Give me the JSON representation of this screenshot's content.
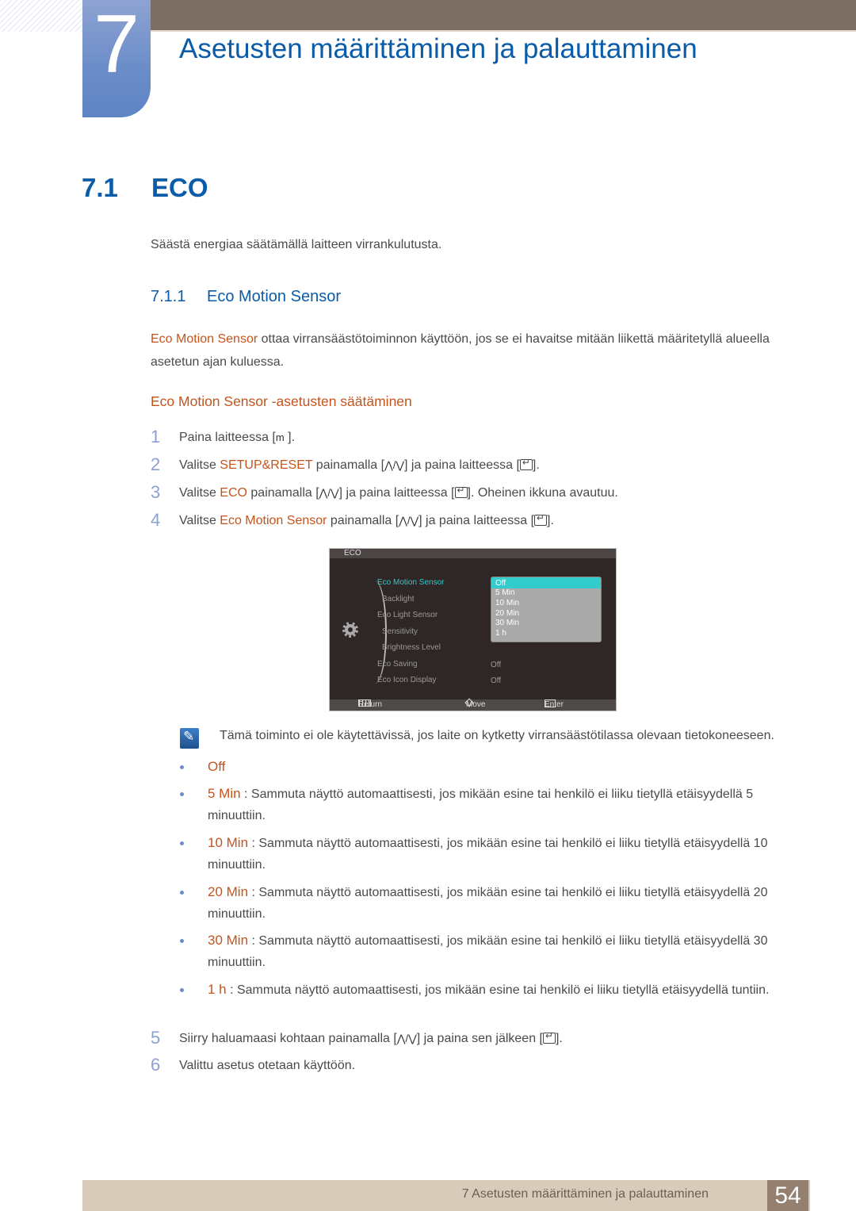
{
  "chapter": {
    "number": "7",
    "title": "Asetusten määrittäminen ja palauttaminen"
  },
  "section": {
    "number": "7.1",
    "title": "ECO",
    "intro": "Säästä energiaa säätämällä laitteen virrankulutusta."
  },
  "subsection": {
    "number": "7.1.1",
    "title": "Eco Motion Sensor",
    "para_term": "Eco Motion Sensor",
    "para_text": " ottaa virransäästötoiminnon käyttöön, jos se ei havaitse mitään liikettä määritetyllä alueella asetetun ajan kuluessa.",
    "procedure_heading": "Eco Motion Sensor -asetusten säätäminen"
  },
  "steps": [
    {
      "num": "1",
      "a": "Paina laitteessa [",
      "key": "m",
      "b": " ]."
    },
    {
      "num": "2",
      "a": "Valitse ",
      "term": "SETUP&RESET",
      "b": " painamalla [",
      "c": "] ja paina laitteessa [",
      "d": "]."
    },
    {
      "num": "3",
      "a": "Valitse ",
      "term": "ECO",
      "b": " painamalla [",
      "c": "] ja paina laitteessa [",
      "d": "]. Oheinen ikkuna avautuu."
    },
    {
      "num": "4",
      "a": "Valitse ",
      "term": "Eco Motion Sensor",
      "b": " painamalla [",
      "c": "] ja paina laitteessa [",
      "d": "]."
    },
    {
      "num": "5",
      "a": "Siirry haluamaasi kohtaan painamalla [",
      "c": "] ja paina sen jälkeen [",
      "d": "]."
    },
    {
      "num": "6",
      "a": "Valittu asetus otetaan käyttöön."
    }
  ],
  "arrows_glyph": "⋀/⋁",
  "osd": {
    "title": "ECO",
    "items": [
      {
        "label": "Eco Motion Sensor",
        "selected": true
      },
      {
        "label": "Backlight"
      },
      {
        "label": "Eco Light Sensor"
      },
      {
        "label": "Sensitivity"
      },
      {
        "label": "Brightness Level"
      },
      {
        "label": "Eco Saving",
        "value": "Off"
      },
      {
        "label": "Eco Icon Display",
        "value": "Off"
      }
    ],
    "dropdown_options": [
      "Off",
      "5 Min",
      "10 Min",
      "20 Min",
      "30 Min",
      "1 h"
    ],
    "dropdown_selected": "Off",
    "footer": {
      "return": "Return",
      "move": "Move",
      "enter": "Enter"
    },
    "accent_color": "#33cccc"
  },
  "note": "Tämä toiminto ei ole käytettävissä, jos laite on kytketty virransäästötilassa olevaan tietokoneeseen.",
  "options": [
    {
      "term": "Off",
      "text": ""
    },
    {
      "term": "5 Min",
      "text": " : Sammuta näyttö automaattisesti, jos mikään esine tai henkilö ei liiku tietyllä etäisyydellä 5 minuuttiin."
    },
    {
      "term": "10 Min",
      "text": " : Sammuta näyttö automaattisesti, jos mikään esine tai henkilö ei liiku tietyllä etäisyydellä 10 minuuttiin."
    },
    {
      "term": "20 Min",
      "text": " : Sammuta näyttö automaattisesti, jos mikään esine tai henkilö ei liiku tietyllä etäisyydellä 20 minuuttiin."
    },
    {
      "term": "30 Min",
      "text": " : Sammuta näyttö automaattisesti, jos mikään esine tai henkilö ei liiku tietyllä etäisyydellä 30 minuuttiin."
    },
    {
      "term": "1 h",
      "text": " : Sammuta näyttö automaattisesti, jos mikään esine tai henkilö ei liiku tietyllä etäisyydellä tuntiin."
    }
  ],
  "footer": {
    "text": "7 Asetusten määrittäminen ja palauttaminen",
    "page": "54"
  },
  "colors": {
    "heading_blue": "#0a5ba8",
    "term_orange": "#c5541c",
    "chapter_tab": "#6a8cc8",
    "top_bar": "#7b6e62",
    "footer_bar": "#d9cbba",
    "page_box": "#938071"
  }
}
